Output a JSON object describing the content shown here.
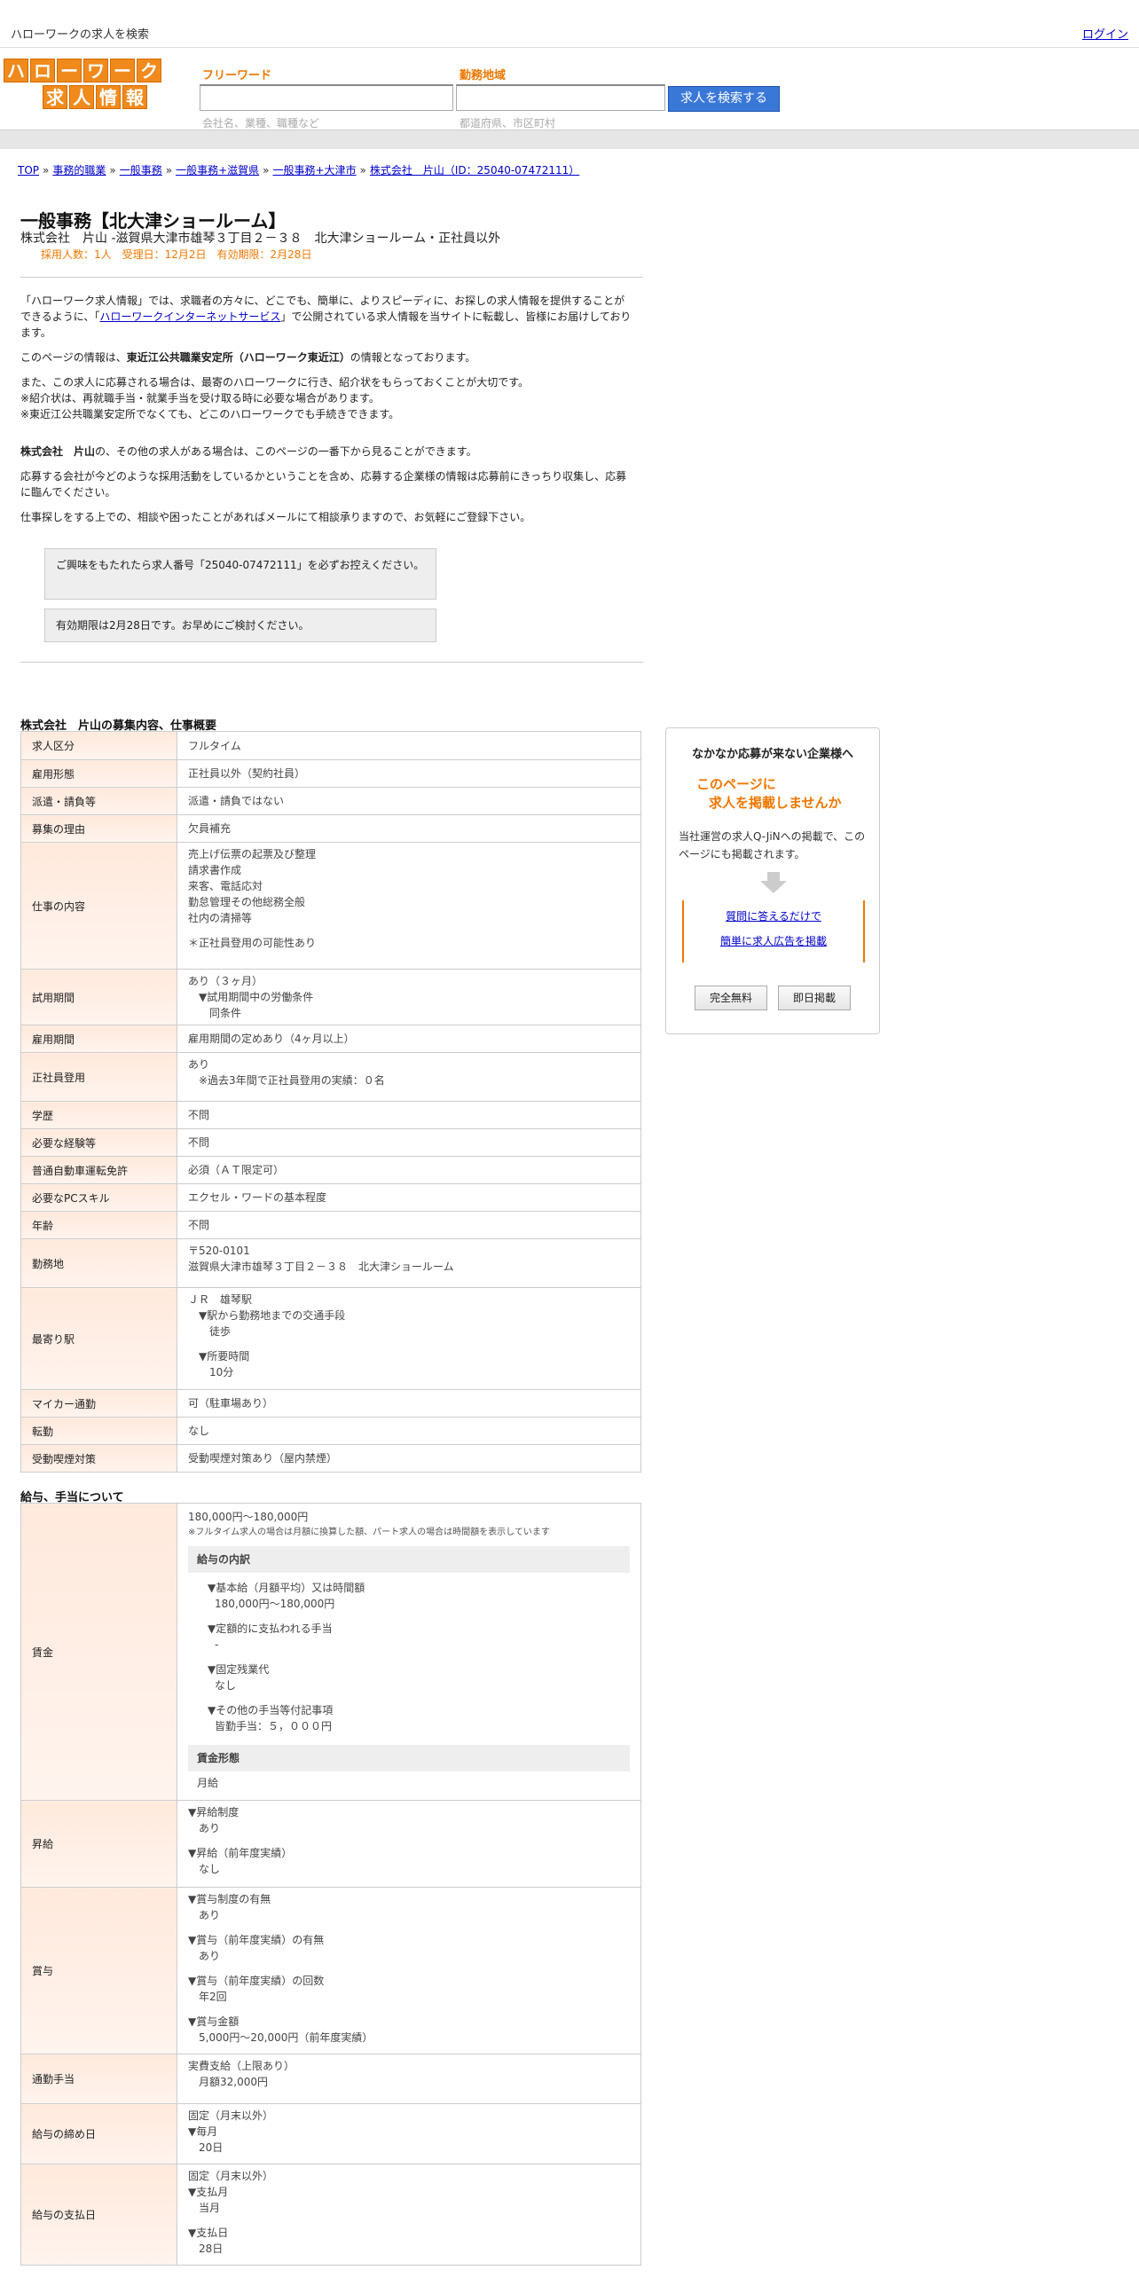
{
  "topbar": {
    "title": "ハローワークの求人を検索",
    "login": "ログイン"
  },
  "logo": {
    "row1": [
      "ハ",
      "ロ",
      "ー",
      "ワ",
      "ー",
      "ク"
    ],
    "row2": [
      "求",
      "人",
      "情",
      "報"
    ]
  },
  "search": {
    "freeword_label": "フリーワード",
    "freeword_placeholder": "会社名、業種、職種など",
    "area_label": "勤務地域",
    "area_placeholder": "都道府県、市区町村",
    "button": "求人を検索する"
  },
  "breadcrumb": [
    {
      "label": "TOP",
      "link": true
    },
    {
      "label": "事務的職業",
      "link": true
    },
    {
      "label": "一般事務",
      "link": true
    },
    {
      "label": "一般事務+滋賀県",
      "link": true
    },
    {
      "label": "一般事務+大津市",
      "link": true
    },
    {
      "label": "株式会社　片山（ID：25040-07472111）",
      "link": true
    }
  ],
  "breadcrumb_sep": "»",
  "job": {
    "title": "一般事務【北大津ショールーム】",
    "subtitle": "株式会社　片山 -滋賀県大津市雄琴３丁目２－３８　北大津ショールーム・正社員以外",
    "meta": "採用人数：1人　受理日：12月2日　有効期限：2月28日"
  },
  "intro": {
    "p1_a": "「ハローワーク求人情報」では、求職者の方々に、どこでも、簡単に、よりスピーディに、お探しの求人情報を提供することができるように、「",
    "p1_link": "ハローワークインターネットサービス",
    "p1_b": "」で公開されている求人情報を当サイトに転載し、皆様にお届けしております。",
    "p2_a": "このページの情報は、",
    "p2_bold": "東近江公共職業安定所（ハローワーク東近江）",
    "p2_b": "の情報となっております。",
    "p3_l1": "また、この求人に応募される場合は、最寄のハローワークに行き、紹介状をもらっておくことが大切です。",
    "p3_l2": "※紹介状は、再就職手当・就業手当を受け取る時に必要な場合があります。",
    "p3_l3": "※東近江公共職業安定所でなくても、どこのハローワークでも手続きできます。",
    "p4_bold": "株式会社　片山",
    "p4_b": "の、その他の求人がある場合は、このページの一番下から見ることができます。",
    "p5": "応募する会社が今どのような採用活動をしているかということを含め、応募する企業様の情報は応募前にきっちり収集し、応募に臨んでください。",
    "p6": "仕事探しをする上での、相談や困ったことがあればメールにて相談承りますので、お気軽にご登録下さい。"
  },
  "notes": [
    "ご興味をもたれたら求人番号「25040-07472111」を必ずお控えください。",
    "有効期限は2月28日です。お早めにご検討ください。"
  ],
  "section1": {
    "title": "株式会社　片山の募集内容、仕事概要",
    "rows": [
      {
        "k": "求人区分",
        "v": [
          "フルタイム"
        ]
      },
      {
        "k": "雇用形態",
        "v": [
          "正社員以外（契約社員）"
        ]
      },
      {
        "k": "派遣・請負等",
        "v": [
          "派遣・請負ではない"
        ]
      },
      {
        "k": "募集の理由",
        "v": [
          "欠員補充"
        ]
      },
      {
        "k": "仕事の内容",
        "v": [
          "売上げ伝票の起票及び整理",
          "請求書作成",
          "来客、電話応対",
          "勤怠管理その他総務全般",
          "社内の清掃等",
          "",
          "＊正社員登用の可能性あり"
        ]
      },
      {
        "k": "試用期間",
        "v": [
          "あり（３ヶ月）",
          "　▼試用期間中の労働条件",
          "　　同条件"
        ]
      },
      {
        "k": "雇用期間",
        "v": [
          "雇用期間の定めあり（4ヶ月以上）"
        ]
      },
      {
        "k": "正社員登用",
        "v": [
          "あり",
          "　※過去3年間で正社員登用の実績：０名"
        ]
      },
      {
        "k": "学歴",
        "v": [
          "不問"
        ]
      },
      {
        "k": "必要な経験等",
        "v": [
          "不問"
        ]
      },
      {
        "k": "普通自動車運転免許",
        "v": [
          "必須（ＡＴ限定可）"
        ]
      },
      {
        "k": "必要なPCスキル",
        "v": [
          "エクセル・ワードの基本程度"
        ]
      },
      {
        "k": "年齢",
        "v": [
          "不問"
        ]
      },
      {
        "k": "勤務地",
        "v": [
          "〒520-0101",
          "滋賀県大津市雄琴３丁目２－３８　北大津ショールーム"
        ]
      },
      {
        "k": "最寄り駅",
        "v": [
          "ＪＲ　雄琴駅",
          "　▼駅から勤務地までの交通手段",
          "　　徒歩",
          "",
          "　▼所要時間",
          "　　10分"
        ]
      },
      {
        "k": "マイカー通勤",
        "v": [
          "可（駐車場あり）"
        ]
      },
      {
        "k": "転勤",
        "v": [
          "なし"
        ]
      },
      {
        "k": "受動喫煙対策",
        "v": [
          "受動喫煙対策あり（屋内禁煙）"
        ]
      }
    ]
  },
  "section2": {
    "title": "給与、手当について",
    "wage_key": "賃金",
    "wage_range": "180,000円〜180,000円",
    "wage_note": "※フルタイム求人の場合は月額に換算した額、パート求人の場合は時間額を表示しています",
    "breakdown_head": "給与の内訳",
    "breakdown": [
      [
        "▼基本給（月額平均）又は時間額",
        "180,000円〜180,000円"
      ],
      [
        "▼定額的に支払われる手当",
        "-"
      ],
      [
        "▼固定残業代",
        "なし"
      ],
      [
        "▼その他の手当等付記事項",
        "皆勤手当：５，０００円"
      ]
    ],
    "form_head": "賃金形態",
    "form_val": "月給",
    "rows": [
      {
        "k": "昇給",
        "v": [
          "▼昇給制度",
          "　あり",
          "",
          "▼昇給（前年度実績）",
          "　なし"
        ]
      },
      {
        "k": "賞与",
        "v": [
          "▼賞与制度の有無",
          "　あり",
          "",
          "▼賞与（前年度実績）の有無",
          "　あり",
          "",
          "▼賞与（前年度実績）の回数",
          "　年2回",
          "",
          "▼賞与金額",
          "　5,000円〜20,000円（前年度実績）"
        ]
      },
      {
        "k": "通勤手当",
        "v": [
          "実費支給（上限あり）",
          "　月額32,000円"
        ]
      },
      {
        "k": "給与の締め日",
        "v": [
          "固定（月末以外）",
          "▼毎月",
          "　20日"
        ]
      },
      {
        "k": "給与の支払日",
        "v": [
          "固定（月末以外）",
          "▼支払月",
          "　当月",
          "",
          "▼支払日",
          "　28日"
        ]
      }
    ]
  },
  "sidebar": {
    "heading": "なかなか応募が来ない企業様へ",
    "orange1": "このページに",
    "orange2": "求人を掲載しませんか",
    "text": "当社運営の求人Q-JiNへの掲載で、このページにも掲載されます。",
    "link1": "質問に答えるだけで",
    "link2": "簡単に求人広告を掲載",
    "btn1": "完全無料",
    "btn2": "即日掲載"
  }
}
